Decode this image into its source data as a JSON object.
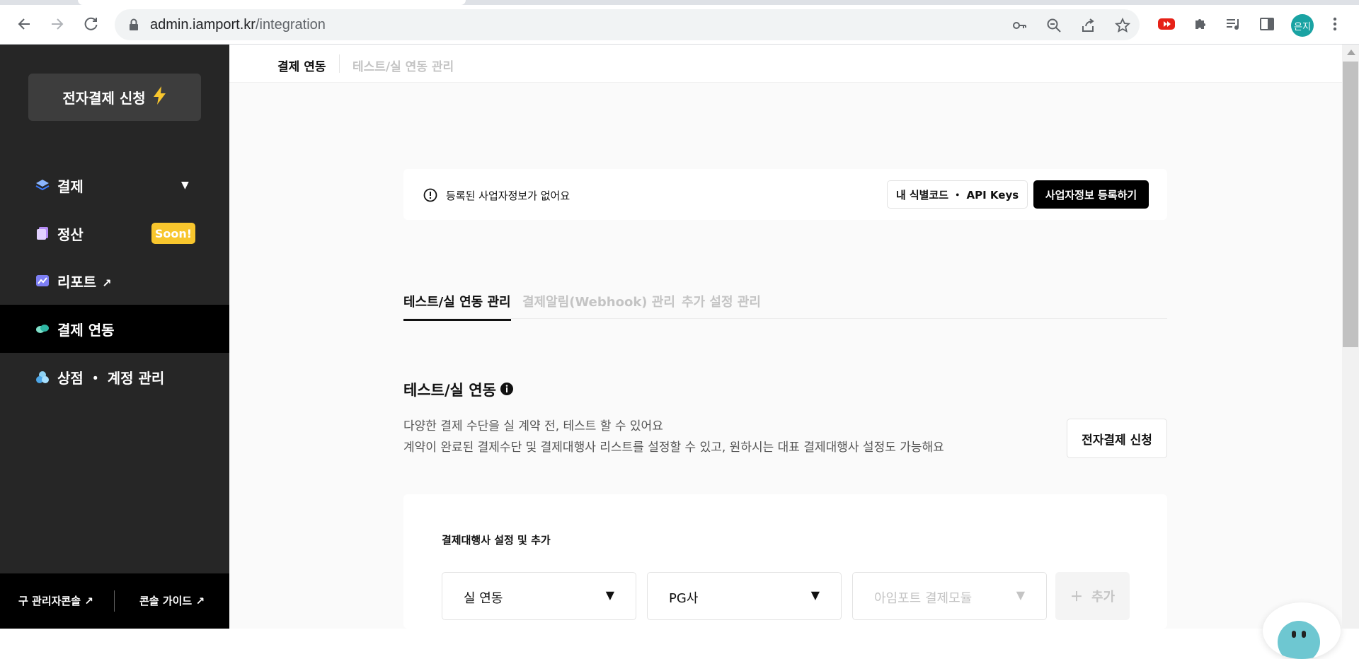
{
  "browser": {
    "url_host": "admin.iamport.kr",
    "url_path": "/integration",
    "profile_initials": "은지",
    "icons": [
      "back-icon",
      "forward-icon",
      "reload-icon",
      "lock-icon",
      "key-icon",
      "zoom-out-icon",
      "share-icon",
      "star-icon",
      "youtube-extension-icon",
      "extensions-puzzle-icon",
      "media-queue-icon",
      "sidepanel-icon",
      "kebab-menu-icon"
    ]
  },
  "sidebar": {
    "apply_button": "전자결제 신청",
    "items": [
      {
        "label": "결제",
        "icon": "layers-icon",
        "has_caret": true
      },
      {
        "label": "정산",
        "icon": "pages-icon",
        "badge": "Soon!"
      },
      {
        "label": "리포트",
        "icon": "chart-icon",
        "external": "↗"
      },
      {
        "label": "결제 연동",
        "icon": "link-icon",
        "active": true
      },
      {
        "label": "상점 ・ 계정 관리",
        "icon": "store-icon"
      }
    ],
    "footer": {
      "left": "구 관리자콘솔 ↗",
      "right": "콘솔 가이드 ↗"
    }
  },
  "topbar": {
    "crumb_active": "결제 연동",
    "crumb_inactive": "테스트/실 연동 관리"
  },
  "notice": {
    "text": "등록된 사업자정보가 없어요",
    "api_button": "내 식별코드 ・ API Keys",
    "register_button": "사업자정보 등록하기"
  },
  "tabs": [
    {
      "label": "테스트/실 연동 관리",
      "active": true
    },
    {
      "label": "결제알림(Webhook) 관리",
      "active": false
    },
    {
      "label": "추가 설정 관리",
      "active": false
    }
  ],
  "section": {
    "title": "테스트/실 연동",
    "desc1": "다양한 결제 수단을 실 계약 전, 테스트 할 수 있어요",
    "desc2": "계약이 완료된 결제수단 및 결제대행사 리스트를 설정할 수 있고, 원하시는 대표 결제대행사 설정도 가능해요",
    "apply_button": "전자결제 신청"
  },
  "card": {
    "title": "결제대행사 설정 및 추가",
    "select_mode": "실 연동",
    "select_pg": "PG사",
    "select_module_placeholder": "아임포트 결제모듈",
    "add_button": "추가"
  },
  "colors": {
    "sidebar_bg": "#262626",
    "active_item_bg": "#000000",
    "badge_yellow": "#f8c62d",
    "main_bg": "#fafafa"
  }
}
